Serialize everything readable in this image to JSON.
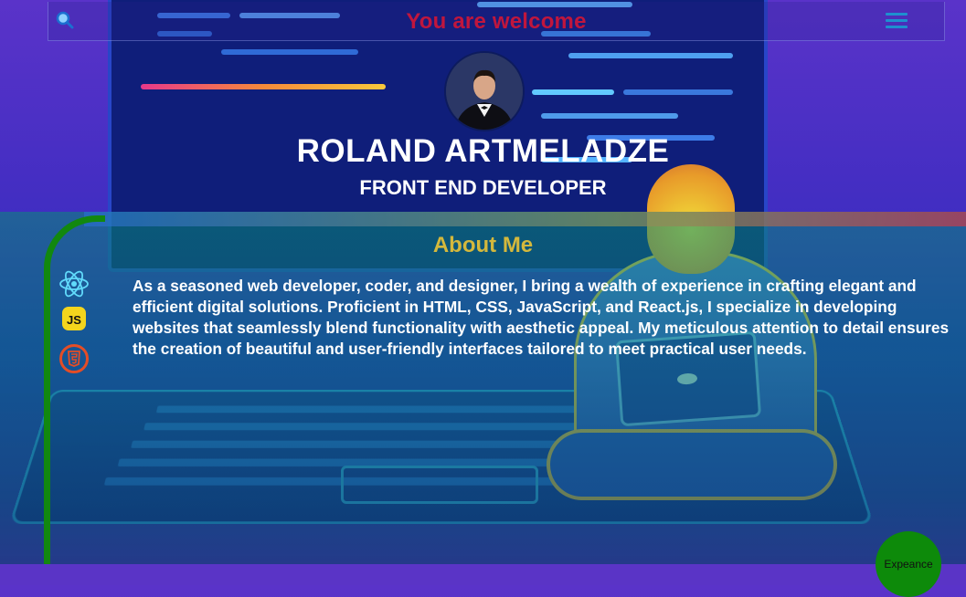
{
  "header": {
    "welcome_text": "You are welcome",
    "search_icon": "search-icon",
    "menu_icon": "hamburger-menu-icon"
  },
  "hero": {
    "name": "ROLAND ARTMELADZE",
    "role": "FRONT END DEVELOPER",
    "avatar": "profile-photo"
  },
  "about": {
    "title": "About Me",
    "text": "As a seasoned web developer, coder, and designer, I bring a wealth of experience in crafting elegant and efficient digital solutions. Proficient in HTML, CSS, JavaScript, and React.js, I specialize in developing websites that seamlessly blend functionality with aesthetic appeal. My meticulous attention to detail ensures the creation of beautiful and user-friendly interfaces tailored to meet practical user needs.",
    "skills": [
      {
        "icon": "react-icon"
      },
      {
        "icon": "javascript-icon",
        "label": "JS"
      },
      {
        "icon": "html5-icon"
      }
    ]
  },
  "floating_button": {
    "label": "Expeance"
  },
  "colors": {
    "welcome": "#c0163d",
    "about_title": "#d4b83c",
    "accent_green": "#12880f",
    "react": "#61dafb",
    "js": "#f3d51d",
    "html5": "#e44d26"
  }
}
